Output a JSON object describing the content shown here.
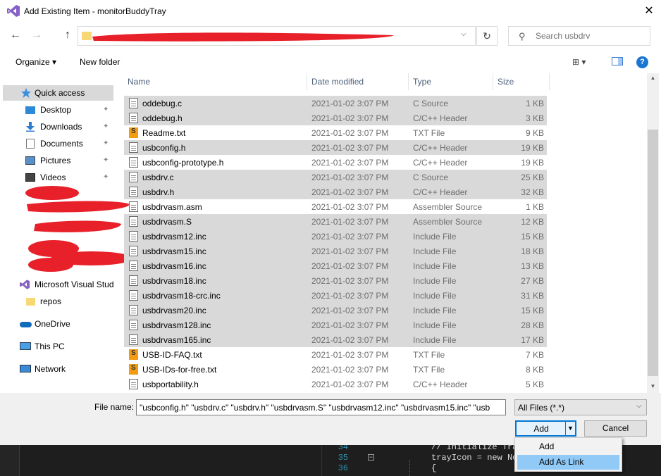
{
  "window": {
    "title": "Add Existing Item - monitorBuddyTray",
    "close": "✕"
  },
  "nav_buttons": {
    "back": "←",
    "forward": "→",
    "up": "↑",
    "refresh": "↻",
    "dropdown": "⌵"
  },
  "address": {
    "path": ""
  },
  "search": {
    "placeholder": "Search usbdrv",
    "icon": "⚲"
  },
  "toolbar": {
    "organize": "Organize ▾",
    "new_folder": "New folder",
    "view": "⊞ ▾",
    "help": "?"
  },
  "nav_pane": {
    "items": [
      {
        "label": "Quick access",
        "icon": "star-icon",
        "active": true
      },
      {
        "label": "Desktop",
        "icon": "desktop-icon",
        "pinned": true
      },
      {
        "label": "Downloads",
        "icon": "downloads-icon",
        "pinned": true
      },
      {
        "label": "Documents",
        "icon": "documents-icon",
        "pinned": true
      },
      {
        "label": "Pictures",
        "icon": "pictures-icon",
        "pinned": true
      },
      {
        "label": "Videos",
        "icon": "videos-icon",
        "pinned": true
      },
      {
        "label": "Microsoft Visual Stud",
        "icon": "visual-studio-icon"
      },
      {
        "label": "repos",
        "icon": "folder-icon"
      },
      {
        "label": "OneDrive",
        "icon": "onedrive-icon"
      },
      {
        "label": "This PC",
        "icon": "pc-icon"
      },
      {
        "label": "Network",
        "icon": "network-icon"
      }
    ],
    "pin_glyph": "📌"
  },
  "columns": {
    "name": "Name",
    "date": "Date modified",
    "type": "Type",
    "size": "Size",
    "sort_arrow": "^"
  },
  "files": [
    {
      "name": "oddebug.c",
      "date": "2021-01-02 3:07 PM",
      "type": "C Source",
      "size": "1 KB",
      "selected": true,
      "icon": "doc"
    },
    {
      "name": "oddebug.h",
      "date": "2021-01-02 3:07 PM",
      "type": "C/C++ Header",
      "size": "3 KB",
      "selected": true,
      "icon": "doc"
    },
    {
      "name": "Readme.txt",
      "date": "2021-01-02 3:07 PM",
      "type": "TXT File",
      "size": "9 KB",
      "selected": false,
      "icon": "sublime"
    },
    {
      "name": "usbconfig.h",
      "date": "2021-01-02 3:07 PM",
      "type": "C/C++ Header",
      "size": "19 KB",
      "selected": true,
      "icon": "doc"
    },
    {
      "name": "usbconfig-prototype.h",
      "date": "2021-01-02 3:07 PM",
      "type": "C/C++ Header",
      "size": "19 KB",
      "selected": false,
      "icon": "doc"
    },
    {
      "name": "usbdrv.c",
      "date": "2021-01-02 3:07 PM",
      "type": "C Source",
      "size": "25 KB",
      "selected": true,
      "icon": "doc"
    },
    {
      "name": "usbdrv.h",
      "date": "2021-01-02 3:07 PM",
      "type": "C/C++ Header",
      "size": "32 KB",
      "selected": true,
      "icon": "doc"
    },
    {
      "name": "usbdrvasm.asm",
      "date": "2021-01-02 3:07 PM",
      "type": "Assembler Source",
      "size": "1 KB",
      "selected": false,
      "icon": "doc"
    },
    {
      "name": "usbdrvasm.S",
      "date": "2021-01-02 3:07 PM",
      "type": "Assembler Source",
      "size": "12 KB",
      "selected": true,
      "icon": "doc"
    },
    {
      "name": "usbdrvasm12.inc",
      "date": "2021-01-02 3:07 PM",
      "type": "Include File",
      "size": "15 KB",
      "selected": true,
      "icon": "doc"
    },
    {
      "name": "usbdrvasm15.inc",
      "date": "2021-01-02 3:07 PM",
      "type": "Include File",
      "size": "18 KB",
      "selected": true,
      "icon": "doc"
    },
    {
      "name": "usbdrvasm16.inc",
      "date": "2021-01-02 3:07 PM",
      "type": "Include File",
      "size": "13 KB",
      "selected": true,
      "icon": "doc"
    },
    {
      "name": "usbdrvasm18.inc",
      "date": "2021-01-02 3:07 PM",
      "type": "Include File",
      "size": "27 KB",
      "selected": true,
      "icon": "doc"
    },
    {
      "name": "usbdrvasm18-crc.inc",
      "date": "2021-01-02 3:07 PM",
      "type": "Include File",
      "size": "31 KB",
      "selected": true,
      "icon": "doc"
    },
    {
      "name": "usbdrvasm20.inc",
      "date": "2021-01-02 3:07 PM",
      "type": "Include File",
      "size": "15 KB",
      "selected": true,
      "icon": "doc"
    },
    {
      "name": "usbdrvasm128.inc",
      "date": "2021-01-02 3:07 PM",
      "type": "Include File",
      "size": "28 KB",
      "selected": true,
      "icon": "doc"
    },
    {
      "name": "usbdrvasm165.inc",
      "date": "2021-01-02 3:07 PM",
      "type": "Include File",
      "size": "17 KB",
      "selected": true,
      "icon": "doc"
    },
    {
      "name": "USB-ID-FAQ.txt",
      "date": "2021-01-02 3:07 PM",
      "type": "TXT File",
      "size": "7 KB",
      "selected": false,
      "icon": "sublime"
    },
    {
      "name": "USB-IDs-for-free.txt",
      "date": "2021-01-02 3:07 PM",
      "type": "TXT File",
      "size": "8 KB",
      "selected": false,
      "icon": "sublime"
    },
    {
      "name": "usbportability.h",
      "date": "2021-01-02 3:07 PM",
      "type": "C/C++ Header",
      "size": "5 KB",
      "selected": false,
      "icon": "doc"
    }
  ],
  "bottom": {
    "file_name_label": "File name:",
    "file_name_value": "\"usbconfig.h\" \"usbdrv.c\" \"usbdrv.h\" \"usbdrvasm.S\" \"usbdrvasm12.inc\" \"usbdrvasm15.inc\" \"usb",
    "filter": "All Files (*.*)",
    "add": "Add",
    "cancel": "Cancel"
  },
  "add_menu": {
    "items": [
      "Add",
      "Add As Link"
    ],
    "highlighted": 1
  },
  "editor": {
    "lines": [
      {
        "no": "34",
        "text": "// Initialize Tray"
      },
      {
        "no": "35",
        "text": "trayIcon = new Not"
      },
      {
        "no": "36",
        "text": "{"
      }
    ]
  }
}
